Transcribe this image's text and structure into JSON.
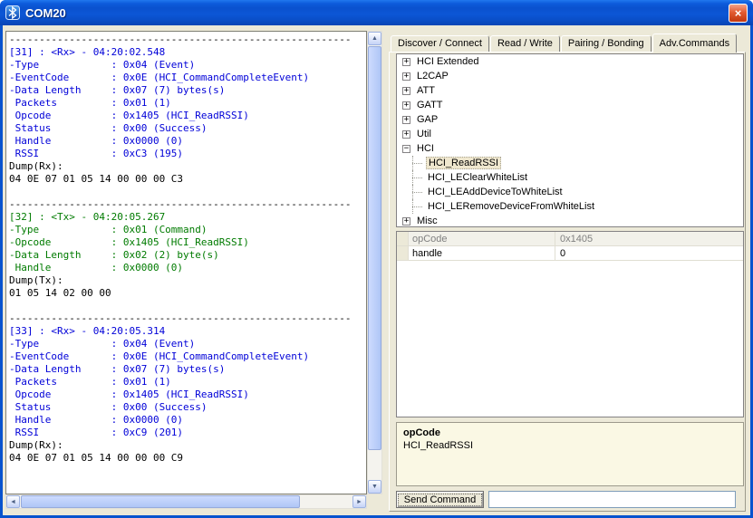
{
  "window": {
    "title": "COM20"
  },
  "colors": {
    "rx": "#0000D8",
    "tx": "#007B00",
    "plain": "#000000",
    "titlebar": "#0A51CE",
    "selection": "#EFE7CE"
  },
  "tabs": {
    "items": [
      "Discover / Connect",
      "Read / Write",
      "Pairing / Bonding",
      "Adv.Commands"
    ],
    "active": "Adv.Commands"
  },
  "log": {
    "entries": [
      {
        "kind": "plain",
        "text": "---------------------------------------------------------"
      },
      {
        "kind": "rx",
        "text": "[31] : <Rx> - 04:20:02.548"
      },
      {
        "kind": "rx",
        "text": "-Type            : 0x04 (Event)"
      },
      {
        "kind": "rx",
        "text": "-EventCode       : 0x0E (HCI_CommandCompleteEvent)"
      },
      {
        "kind": "rx",
        "text": "-Data Length     : 0x07 (7) bytes(s)"
      },
      {
        "kind": "rx",
        "text": " Packets         : 0x01 (1)"
      },
      {
        "kind": "rx",
        "text": " Opcode          : 0x1405 (HCI_ReadRSSI)"
      },
      {
        "kind": "rx",
        "text": " Status          : 0x00 (Success)"
      },
      {
        "kind": "rx",
        "text": " Handle          : 0x0000 (0)"
      },
      {
        "kind": "rx",
        "text": " RSSI            : 0xC3 (195)"
      },
      {
        "kind": "plain",
        "text": "Dump(Rx): "
      },
      {
        "kind": "plain",
        "text": "04 0E 07 01 05 14 00 00 00 C3 "
      },
      {
        "kind": "plain",
        "text": ""
      },
      {
        "kind": "plain",
        "text": "---------------------------------------------------------"
      },
      {
        "kind": "tx",
        "text": "[32] : <Tx> - 04:20:05.267"
      },
      {
        "kind": "tx",
        "text": "-Type            : 0x01 (Command)"
      },
      {
        "kind": "tx",
        "text": "-Opcode          : 0x1405 (HCI_ReadRSSI)"
      },
      {
        "kind": "tx",
        "text": "-Data Length     : 0x02 (2) byte(s)"
      },
      {
        "kind": "tx",
        "text": " Handle          : 0x0000 (0)"
      },
      {
        "kind": "plain",
        "text": "Dump(Tx): "
      },
      {
        "kind": "plain",
        "text": "01 05 14 02 00 00 "
      },
      {
        "kind": "plain",
        "text": ""
      },
      {
        "kind": "plain",
        "text": "---------------------------------------------------------"
      },
      {
        "kind": "rx",
        "text": "[33] : <Rx> - 04:20:05.314"
      },
      {
        "kind": "rx",
        "text": "-Type            : 0x04 (Event)"
      },
      {
        "kind": "rx",
        "text": "-EventCode       : 0x0E (HCI_CommandCompleteEvent)"
      },
      {
        "kind": "rx",
        "text": "-Data Length     : 0x07 (7) bytes(s)"
      },
      {
        "kind": "rx",
        "text": " Packets         : 0x01 (1)"
      },
      {
        "kind": "rx",
        "text": " Opcode          : 0x1405 (HCI_ReadRSSI)"
      },
      {
        "kind": "rx",
        "text": " Status          : 0x00 (Success)"
      },
      {
        "kind": "rx",
        "text": " Handle          : 0x0000 (0)"
      },
      {
        "kind": "rx",
        "text": " RSSI            : 0xC9 (201)"
      },
      {
        "kind": "plain",
        "text": "Dump(Rx): "
      },
      {
        "kind": "plain",
        "text": "04 0E 07 01 05 14 00 00 00 C9 "
      }
    ]
  },
  "tree": {
    "items": [
      {
        "label": "HCI Extended",
        "level": 0,
        "expanded": false
      },
      {
        "label": "L2CAP",
        "level": 0,
        "expanded": false
      },
      {
        "label": "ATT",
        "level": 0,
        "expanded": false
      },
      {
        "label": "GATT",
        "level": 0,
        "expanded": false
      },
      {
        "label": "GAP",
        "level": 0,
        "expanded": false
      },
      {
        "label": "Util",
        "level": 0,
        "expanded": false
      },
      {
        "label": "HCI",
        "level": 0,
        "expanded": true
      },
      {
        "label": "HCI_ReadRSSI",
        "level": 1,
        "selected": true
      },
      {
        "label": "HCI_LEClearWhiteList",
        "level": 1
      },
      {
        "label": "HCI_LEAddDeviceToWhiteList",
        "level": 1
      },
      {
        "label": "HCI_LERemoveDeviceFromWhiteList",
        "level": 1
      },
      {
        "label": "Misc",
        "level": 0,
        "expanded": false
      }
    ]
  },
  "property_grid": {
    "rows": [
      {
        "name": "opCode",
        "value": "0x1405",
        "readonly": true
      },
      {
        "name": "handle",
        "value": "0",
        "readonly": false
      }
    ]
  },
  "help": {
    "title": "opCode",
    "text": "HCI_ReadRSSI"
  },
  "actions": {
    "send_button": "Send Command",
    "command_input_value": ""
  }
}
